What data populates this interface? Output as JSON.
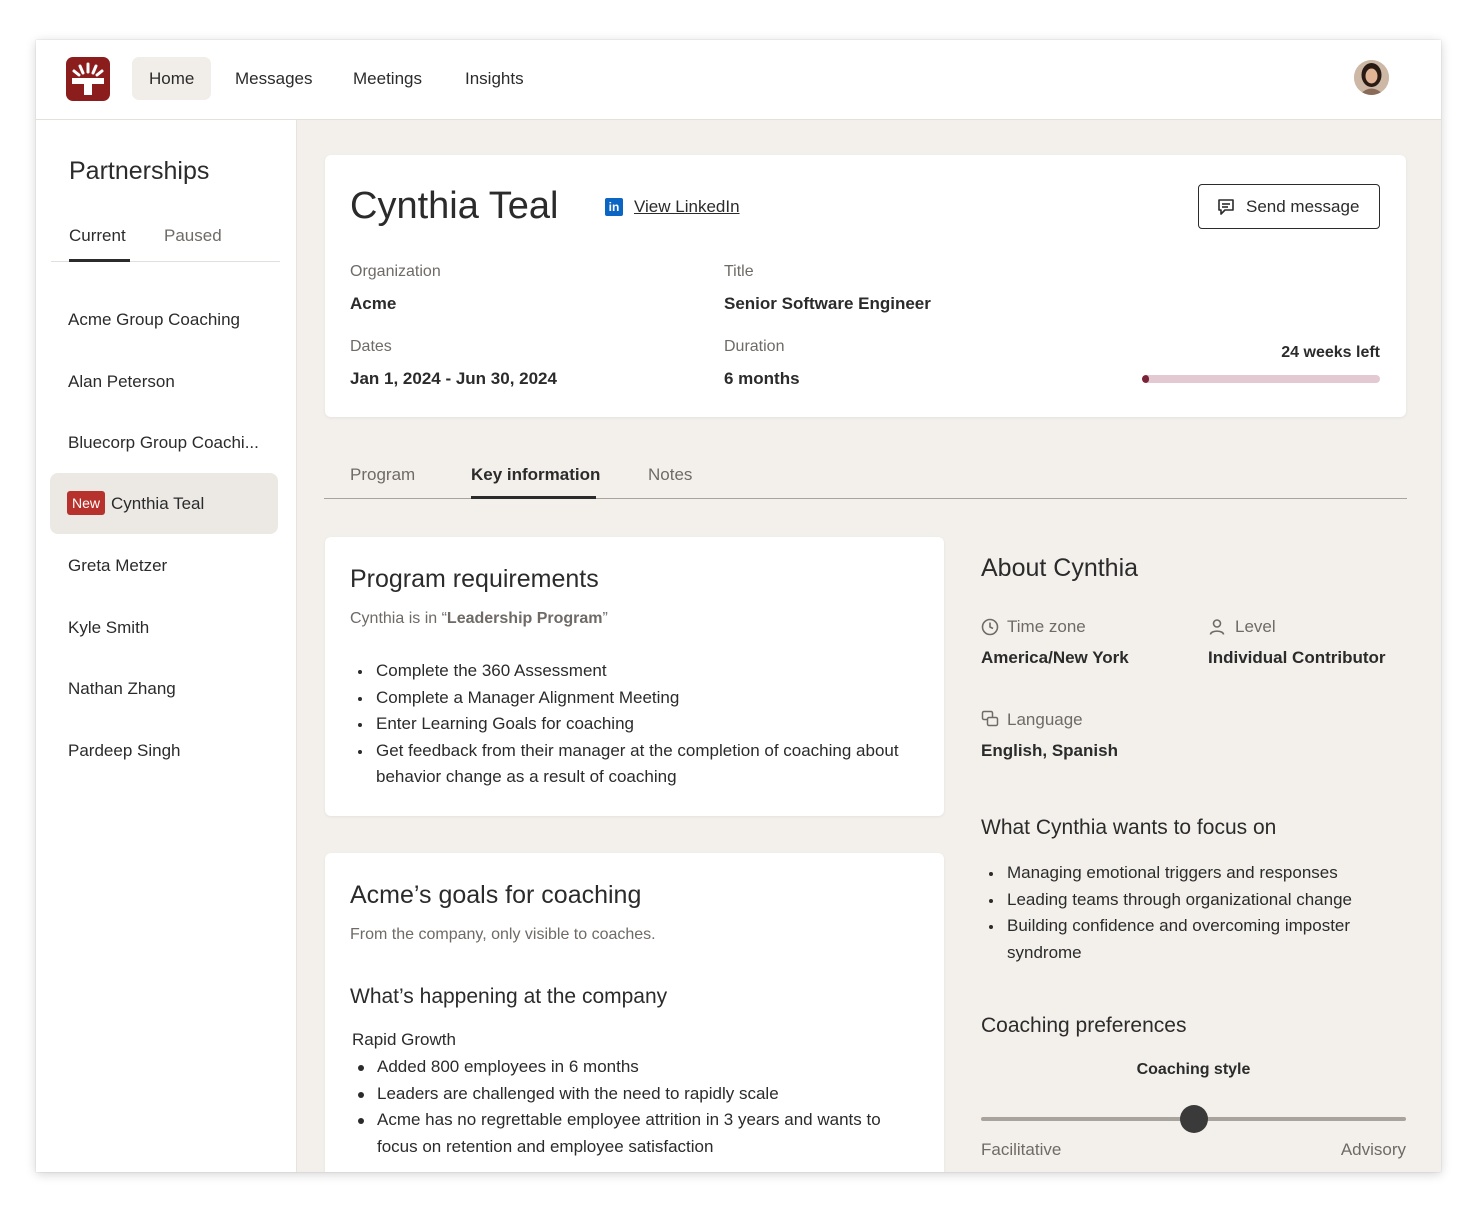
{
  "nav": {
    "items": [
      {
        "label": "Home",
        "active": true
      },
      {
        "label": "Messages"
      },
      {
        "label": "Meetings"
      },
      {
        "label": "Insights"
      }
    ]
  },
  "sidebar": {
    "title": "Partnerships",
    "tabs": [
      "Current",
      "Paused"
    ],
    "items": [
      {
        "label": "Acme Group Coaching"
      },
      {
        "label": "Alan Peterson"
      },
      {
        "label": "Bluecorp Group Coachi..."
      },
      {
        "label": "Cynthia Teal",
        "badge": "New",
        "active": true
      },
      {
        "label": "Greta Metzer"
      },
      {
        "label": "Kyle Smith"
      },
      {
        "label": "Nathan Zhang"
      },
      {
        "label": "Pardeep Singh"
      }
    ]
  },
  "profile": {
    "name": "Cynthia Teal",
    "linkedin_label": "View LinkedIn",
    "send_label": "Send message",
    "org_label": "Organization",
    "org_value": "Acme",
    "title_label": "Title",
    "title_value": "Senior Software Engineer",
    "dates_label": "Dates",
    "dates_value": "Jan 1, 2024 - Jun 30, 2024",
    "duration_label": "Duration",
    "duration_value": "6 months",
    "weeks_left": "24 weeks left",
    "progress_fraction": 0.03
  },
  "tabs": [
    "Program",
    "Key information",
    "Notes"
  ],
  "requirements": {
    "title": "Program requirements",
    "intro_prefix": "Cynthia is in “",
    "program_name": "Leadership Program",
    "intro_suffix": "”",
    "items": [
      "Complete the 360 Assessment",
      "Complete a Manager Alignment Meeting",
      "Enter Learning Goals for coaching",
      "Get feedback from their manager at the completion of coaching about behavior change as a result of coaching"
    ]
  },
  "goals": {
    "title": "Acme’s goals for coaching",
    "subtitle": "From the company, only visible to coaches.",
    "section_title": "What’s happening at the company",
    "group_label": "Rapid Growth",
    "items": [
      "Added 800 employees in 6 months",
      "Leaders are challenged with the need to rapidly scale",
      "Acme has no regrettable employee attrition in 3 years and wants to focus on retention and employee satisfaction"
    ]
  },
  "about": {
    "title": "About Cynthia",
    "timezone_label": "Time zone",
    "timezone_value": "America/New York",
    "level_label": "Level",
    "level_value": "Individual Contributor",
    "language_label": "Language",
    "language_value": "English, Spanish",
    "focus_title": "What Cynthia wants to focus on",
    "focus_items": [
      "Managing emotional triggers and responses",
      "Leading teams through organizational change",
      "Building confidence and overcoming imposter syndrome"
    ],
    "prefs_title": "Coaching preferences",
    "style_label": "Coaching style",
    "style_min": "Facilitative",
    "style_max": "Advisory",
    "style_value": 0.5
  },
  "colors": {
    "brand": "#8b1d1d",
    "badge": "#b7322c",
    "progress_fill": "#7a2336",
    "progress_track": "#e3c9d2",
    "linkedin": "#0a66c2"
  }
}
